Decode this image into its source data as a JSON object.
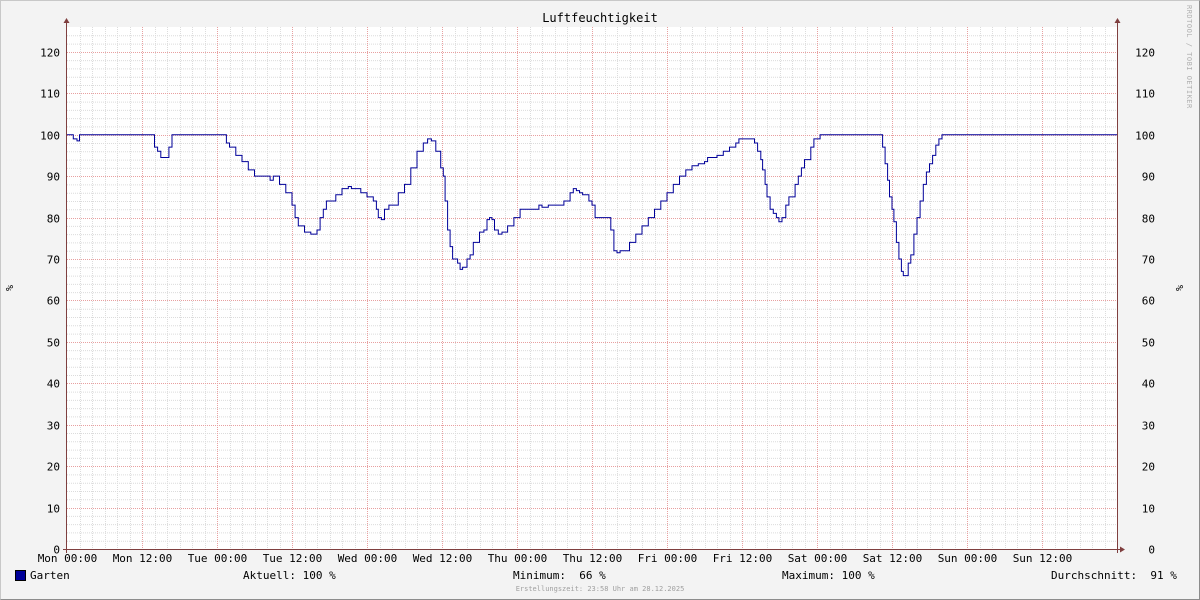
{
  "chart_data": {
    "type": "line",
    "title": "Luftfeuchtigkeit",
    "ylabel_left": "%",
    "ylabel_right": "%",
    "ylim": [
      0,
      126
    ],
    "yticks": [
      0,
      10,
      20,
      30,
      40,
      50,
      60,
      70,
      80,
      90,
      100,
      110,
      120
    ],
    "x_unit": "hours since Mon 00:00",
    "xlim": [
      0,
      168
    ],
    "xticks": [
      {
        "x": 0,
        "label": "Mon 00:00"
      },
      {
        "x": 12,
        "label": "Mon 12:00"
      },
      {
        "x": 24,
        "label": "Tue 00:00"
      },
      {
        "x": 36,
        "label": "Tue 12:00"
      },
      {
        "x": 48,
        "label": "Wed 00:00"
      },
      {
        "x": 60,
        "label": "Wed 12:00"
      },
      {
        "x": 72,
        "label": "Thu 00:00"
      },
      {
        "x": 84,
        "label": "Thu 12:00"
      },
      {
        "x": 96,
        "label": "Fri 00:00"
      },
      {
        "x": 108,
        "label": "Fri 12:00"
      },
      {
        "x": 120,
        "label": "Sat 00:00"
      },
      {
        "x": 132,
        "label": "Sat 12:00"
      },
      {
        "x": 144,
        "label": "Sun 00:00"
      },
      {
        "x": 156,
        "label": "Sun 12:00"
      }
    ],
    "grid": true,
    "series": [
      {
        "name": "Garten",
        "color": "#000099",
        "points": [
          [
            0,
            100
          ],
          [
            1,
            99
          ],
          [
            1.6,
            98.5
          ],
          [
            2,
            100
          ],
          [
            13.5,
            100
          ],
          [
            14,
            97
          ],
          [
            14.5,
            96
          ],
          [
            15,
            94.5
          ],
          [
            15.8,
            94.5
          ],
          [
            16.3,
            97
          ],
          [
            16.8,
            100
          ],
          [
            25,
            100
          ],
          [
            25.5,
            98
          ],
          [
            26,
            97
          ],
          [
            27,
            95
          ],
          [
            28,
            93.5
          ],
          [
            29,
            91.5
          ],
          [
            30,
            90
          ],
          [
            32,
            90
          ],
          [
            32.5,
            89
          ],
          [
            33,
            90
          ],
          [
            34,
            88
          ],
          [
            35,
            86
          ],
          [
            36,
            83
          ],
          [
            36.5,
            80
          ],
          [
            37,
            78
          ],
          [
            38,
            76.5
          ],
          [
            39,
            76
          ],
          [
            39.5,
            76
          ],
          [
            40,
            77
          ],
          [
            40.5,
            80
          ],
          [
            41,
            82
          ],
          [
            41.5,
            84
          ],
          [
            43,
            85.5
          ],
          [
            44,
            87
          ],
          [
            44.5,
            87
          ],
          [
            45,
            87.5
          ],
          [
            45.5,
            87
          ],
          [
            46.5,
            87
          ],
          [
            47,
            86
          ],
          [
            48,
            85
          ],
          [
            49,
            84
          ],
          [
            49.5,
            82
          ],
          [
            49.8,
            80
          ],
          [
            50.3,
            79.5
          ],
          [
            50.8,
            82
          ],
          [
            51.5,
            83
          ],
          [
            53,
            86
          ],
          [
            54,
            88
          ],
          [
            55,
            92
          ],
          [
            56,
            96
          ],
          [
            57,
            98
          ],
          [
            57.7,
            99
          ],
          [
            58.3,
            98.5
          ],
          [
            59,
            96
          ],
          [
            59.8,
            92
          ],
          [
            60.2,
            90
          ],
          [
            60.5,
            84
          ],
          [
            60.9,
            77
          ],
          [
            61.3,
            73
          ],
          [
            61.7,
            70
          ],
          [
            62.5,
            69
          ],
          [
            62.9,
            67.5
          ],
          [
            63.3,
            68
          ],
          [
            64,
            70
          ],
          [
            64.5,
            71
          ],
          [
            65,
            74
          ],
          [
            66,
            76.5
          ],
          [
            66.7,
            77
          ],
          [
            67.2,
            79.5
          ],
          [
            67.6,
            80
          ],
          [
            68,
            79.5
          ],
          [
            68.4,
            77
          ],
          [
            69,
            76
          ],
          [
            69.6,
            76.5
          ],
          [
            70.5,
            78
          ],
          [
            71.5,
            80
          ],
          [
            72.5,
            82
          ],
          [
            75,
            82
          ],
          [
            75.5,
            83
          ],
          [
            76,
            82.5
          ],
          [
            77,
            83
          ],
          [
            78,
            83
          ],
          [
            79.5,
            84
          ],
          [
            80.5,
            86
          ],
          [
            81,
            87
          ],
          [
            81.5,
            86.5
          ],
          [
            82,
            86
          ],
          [
            82.5,
            85.5
          ],
          [
            83.5,
            84
          ],
          [
            84,
            83
          ],
          [
            84.5,
            80
          ],
          [
            86.5,
            80
          ],
          [
            87,
            77
          ],
          [
            87.5,
            72
          ],
          [
            88,
            71.5
          ],
          [
            88.5,
            72
          ],
          [
            89,
            72
          ],
          [
            90,
            74
          ],
          [
            91,
            76
          ],
          [
            92,
            78
          ],
          [
            93,
            80
          ],
          [
            94,
            82
          ],
          [
            95,
            84
          ],
          [
            96,
            86
          ],
          [
            97,
            88
          ],
          [
            98,
            90
          ],
          [
            99,
            91.5
          ],
          [
            100,
            92.5
          ],
          [
            101,
            93
          ],
          [
            102,
            93.5
          ],
          [
            102.5,
            94.5
          ],
          [
            104,
            95
          ],
          [
            105,
            96
          ],
          [
            106,
            97
          ],
          [
            107,
            98
          ],
          [
            107.5,
            99
          ],
          [
            109,
            99
          ],
          [
            110,
            98
          ],
          [
            110.5,
            96
          ],
          [
            111,
            94
          ],
          [
            111.3,
            91.5
          ],
          [
            111.7,
            88
          ],
          [
            112,
            85
          ],
          [
            112.5,
            82
          ],
          [
            113,
            81
          ],
          [
            113.5,
            80
          ],
          [
            113.9,
            79
          ],
          [
            114.4,
            80
          ],
          [
            115,
            83
          ],
          [
            115.5,
            85
          ],
          [
            116.5,
            88
          ],
          [
            117,
            90
          ],
          [
            117.5,
            92
          ],
          [
            118,
            94
          ],
          [
            119,
            97
          ],
          [
            119.5,
            99
          ],
          [
            120.5,
            100
          ],
          [
            130,
            100
          ],
          [
            130.5,
            97
          ],
          [
            130.9,
            93
          ],
          [
            131.3,
            89
          ],
          [
            131.6,
            85
          ],
          [
            132,
            82
          ],
          [
            132.3,
            79
          ],
          [
            132.7,
            74
          ],
          [
            133.1,
            70
          ],
          [
            133.5,
            67
          ],
          [
            133.8,
            66
          ],
          [
            134.2,
            66
          ],
          [
            134.6,
            69
          ],
          [
            135,
            71
          ],
          [
            135.5,
            76
          ],
          [
            136,
            80
          ],
          [
            136.5,
            84
          ],
          [
            137,
            88
          ],
          [
            137.5,
            91
          ],
          [
            138,
            93
          ],
          [
            138.5,
            95
          ],
          [
            139,
            97.5
          ],
          [
            139.5,
            99
          ],
          [
            140,
            100
          ],
          [
            168,
            100
          ]
        ]
      }
    ]
  },
  "legend": {
    "series_label": "Garten",
    "series_color": "#000099",
    "aktuell": "Aktuell: 100 %",
    "minimum": "Minimum:  66 %",
    "maximum": "Maximum: 100 %",
    "durchschnitt": "Durchschnitt:  91 %"
  },
  "footer": "Erstellungszeit: 23:58 Uhr am 28.12.2025",
  "watermark": "RRDTOOL / TOBI OETIKER",
  "colors": {
    "background": "#f3f3f3",
    "canvas": "#ffffff",
    "major_grid": "#e8a0a0",
    "minor_grid": "#dcdcdc",
    "axis": "#7f3f3f",
    "line": "#000099"
  }
}
